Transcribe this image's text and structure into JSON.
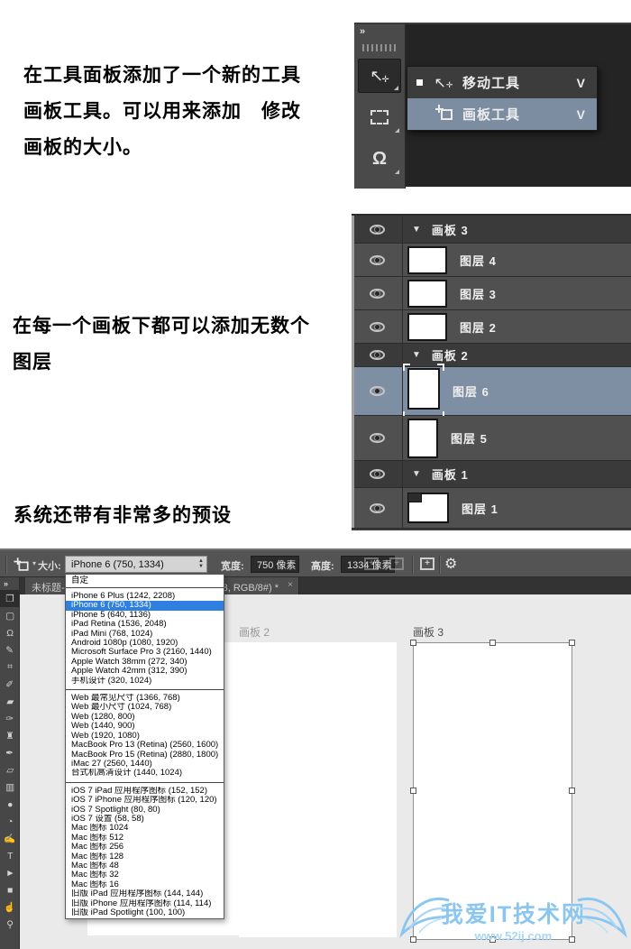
{
  "paragraphs": {
    "p1_line1": "在工具面板添加了一个新的工具",
    "p1_line2": "画板工具。可以用来添加　修改",
    "p1_line3": "画板的大小。",
    "p2_line1": "在每一个画板下都可以添加无数个",
    "p2_line2": "图层",
    "p3_line1": "系统还带有非常多的预设"
  },
  "tools_flyout": {
    "collapse_icon": "»",
    "items": [
      {
        "label": "移动工具",
        "shortcut": "V",
        "selected": false
      },
      {
        "label": "画板工具",
        "shortcut": "V",
        "selected": true
      }
    ]
  },
  "layers_panel": {
    "rows": [
      {
        "type": "artboard",
        "label": "画板 3"
      },
      {
        "type": "layer",
        "label": "图层 4"
      },
      {
        "type": "layer",
        "label": "图层 3"
      },
      {
        "type": "layer",
        "label": "图层 2"
      },
      {
        "type": "artboard",
        "label": "画板 2"
      },
      {
        "type": "layer",
        "label": "图层 6",
        "selected": true
      },
      {
        "type": "layer",
        "label": "图层 5"
      },
      {
        "type": "artboard",
        "label": "画板 1"
      },
      {
        "type": "layer",
        "label": "图层 1"
      }
    ]
  },
  "options_bar": {
    "size_label": "大小:",
    "size_value": "iPhone 6 (750, 1334)",
    "width_label": "宽度:",
    "width_value": "750 像素",
    "height_label": "高度:",
    "height_value": "1334 像素",
    "add_artboard_icon": "+",
    "gear_icon": "⚙"
  },
  "tab_bar": {
    "title_left": "未标题-1",
    "title_right": "板 3, RGB/8#) *",
    "close": "×"
  },
  "toolstrip": {
    "collapse_icon": "»",
    "tools": [
      {
        "name": "artboard-tool",
        "glyph": "❐",
        "selected": true
      },
      {
        "name": "marquee-tool",
        "glyph": "▢"
      },
      {
        "name": "lasso-tool",
        "glyph": "Ω"
      },
      {
        "name": "quick-selection-tool",
        "glyph": "✎"
      },
      {
        "name": "crop-tool",
        "glyph": "⌗"
      },
      {
        "name": "eyedropper-tool",
        "glyph": "✐"
      },
      {
        "name": "spot-healing-tool",
        "glyph": "▰"
      },
      {
        "name": "brush-tool",
        "glyph": "✑"
      },
      {
        "name": "clone-stamp-tool",
        "glyph": "♜"
      },
      {
        "name": "history-brush-tool",
        "glyph": "✒"
      },
      {
        "name": "eraser-tool",
        "glyph": "▱"
      },
      {
        "name": "gradient-tool",
        "glyph": "▥"
      },
      {
        "name": "blur-tool",
        "glyph": "●"
      },
      {
        "name": "dodge-tool",
        "glyph": "◔"
      },
      {
        "name": "pen-tool",
        "glyph": "✍"
      },
      {
        "name": "type-tool",
        "glyph": "T"
      },
      {
        "name": "path-selection-tool",
        "glyph": "►"
      },
      {
        "name": "rectangle-tool",
        "glyph": "■"
      },
      {
        "name": "hand-tool",
        "glyph": "☝"
      },
      {
        "name": "zoom-tool",
        "glyph": "⚲"
      }
    ]
  },
  "canvas": {
    "artboard2_label": "画板 2",
    "artboard3_label": "画板 3",
    "watermark_title": "我爱IT技术网",
    "watermark_url": "www.52ij.com"
  },
  "preset_dropdown": {
    "custom_item": "自定",
    "groups": [
      [
        {
          "label": "iPhone 6 Plus (1242, 2208)"
        },
        {
          "label": "iPhone 6 (750, 1334)",
          "selected": true
        },
        {
          "label": "iPhone 5 (640, 1136)"
        },
        {
          "label": "iPad Retina (1536, 2048)"
        },
        {
          "label": "iPad Mini (768, 1024)"
        },
        {
          "label": "Android 1080p (1080, 1920)"
        },
        {
          "label": "Microsoft Surface Pro 3 (2160, 1440)"
        },
        {
          "label": "Apple Watch 38mm (272, 340)"
        },
        {
          "label": "Apple Watch 42mm (312, 390)"
        },
        {
          "label": "手机设计 (320, 1024)"
        }
      ],
      [
        {
          "label": "Web 最常见尺寸 (1366, 768)"
        },
        {
          "label": "Web 最小尺寸 (1024, 768)"
        },
        {
          "label": "Web (1280, 800)"
        },
        {
          "label": "Web (1440, 900)"
        },
        {
          "label": "Web (1920, 1080)"
        },
        {
          "label": "MacBook Pro 13 (Retina) (2560, 1600)"
        },
        {
          "label": "MacBook Pro 15 (Retina) (2880, 1800)"
        },
        {
          "label": "iMac 27 (2560, 1440)"
        },
        {
          "label": "台式机高清设计 (1440, 1024)"
        }
      ],
      [
        {
          "label": "iOS 7 iPad 应用程序图标 (152, 152)"
        },
        {
          "label": "iOS 7 iPhone 应用程序图标 (120, 120)"
        },
        {
          "label": "iOS 7 Spotlight (80, 80)"
        },
        {
          "label": "iOS 7 设置 (58, 58)"
        },
        {
          "label": "Mac 图标 1024"
        },
        {
          "label": "Mac 图标 512"
        },
        {
          "label": "Mac 图标 256"
        },
        {
          "label": "Mac 图标 128"
        },
        {
          "label": "Mac 图标 48"
        },
        {
          "label": "Mac 图标 32"
        },
        {
          "label": "Mac 图标 16"
        },
        {
          "label": "旧版 iPad 应用程序图标 (144, 144)"
        },
        {
          "label": "旧版 iPhone 应用程序图标 (114, 114)"
        },
        {
          "label": "旧版 iPad Spotlight (100, 100)"
        }
      ]
    ]
  },
  "colors": {
    "menu_highlight": "#7c8da2",
    "layer_selected": "#7e8ea3",
    "dropdown_selected": "#2e7fe0",
    "watermark_blue": "#8ac6f0",
    "panel_dark": "#242424",
    "bar_gray": "#545454",
    "canvas_gray": "#eaeaea"
  }
}
